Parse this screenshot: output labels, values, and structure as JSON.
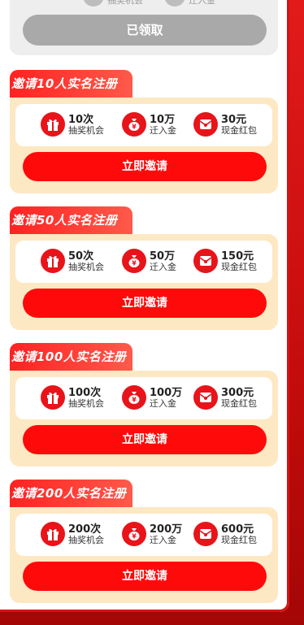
{
  "top_card": {
    "claimed_label": "已领取",
    "lottery_label": "抽奖机会",
    "fund_label": "迁入金"
  },
  "tasks": [
    {
      "title": "邀请10人实名注册",
      "rewards": [
        {
          "value": "10次",
          "label": "抽奖机会",
          "icon": "gift-icon"
        },
        {
          "value": "10万",
          "label": "迁入金",
          "icon": "money-bag-icon"
        },
        {
          "value": "30元",
          "label": "现金红包",
          "icon": "red-envelope-icon"
        }
      ],
      "button": "立即邀请"
    },
    {
      "title": "邀请50人实名注册",
      "rewards": [
        {
          "value": "50次",
          "label": "抽奖机会",
          "icon": "gift-icon"
        },
        {
          "value": "50万",
          "label": "迁入金",
          "icon": "money-bag-icon"
        },
        {
          "value": "150元",
          "label": "现金红包",
          "icon": "red-envelope-icon"
        }
      ],
      "button": "立即邀请"
    },
    {
      "title": "邀请100人实名注册",
      "rewards": [
        {
          "value": "100次",
          "label": "抽奖机会",
          "icon": "gift-icon"
        },
        {
          "value": "100万",
          "label": "迁入金",
          "icon": "money-bag-icon"
        },
        {
          "value": "300元",
          "label": "现金红包",
          "icon": "red-envelope-icon"
        }
      ],
      "button": "立即邀请"
    },
    {
      "title": "邀请200人实名注册",
      "rewards": [
        {
          "value": "200次",
          "label": "抽奖机会",
          "icon": "gift-icon"
        },
        {
          "value": "200万",
          "label": "迁入金",
          "icon": "money-bag-icon"
        },
        {
          "value": "600元",
          "label": "现金红包",
          "icon": "red-envelope-icon"
        }
      ],
      "button": "立即邀请"
    }
  ],
  "colors": {
    "accent": "#ff0a0a",
    "tab_gradient_start": "#ff2222",
    "card_background": "#fde8c4",
    "claimed_button": "#a9a9a9",
    "page_background": "#c40c0c"
  }
}
